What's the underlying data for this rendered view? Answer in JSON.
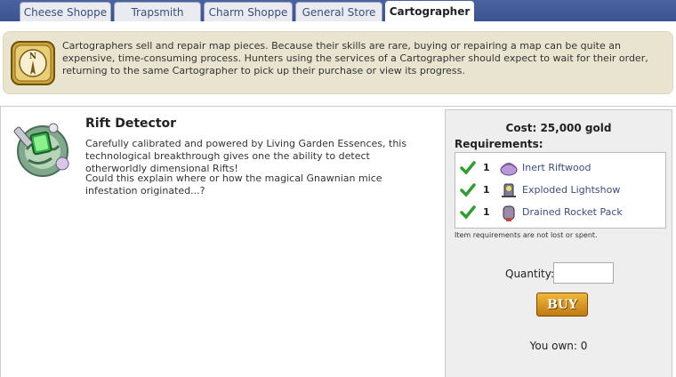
{
  "tabs": [
    {
      "label": "Cheese Shoppe",
      "active": false
    },
    {
      "label": "Trapsmith",
      "active": false
    },
    {
      "label": "Charm Shoppe",
      "active": false
    },
    {
      "label": "General Store",
      "active": false
    },
    {
      "label": "Cartographer",
      "active": true
    }
  ],
  "info": {
    "icon": "compass-icon",
    "text": "Cartographers sell and repair map pieces. Because their skills are rare, buying or repairing a map can be quite an expensive, time-consuming process. Hunters using the services of a Cartographer should expect to wait for their order, returning to the same Cartographer to pick up their purchase or view its progress."
  },
  "item": {
    "name": "Rift Detector",
    "description": "Carefully calibrated and powered by Living Garden Essences, this technological breakthrough gives one the ability to detect otherworldly dimensional Rifts!",
    "description2": "Could this explain where or how the magical Gnawnian mice infestation originated...?",
    "icon": "rift-detector-icon"
  },
  "purchase": {
    "cost": "Cost: 25,000 gold",
    "requirements_title": "Requirements:",
    "requirements": [
      {
        "qty": "1",
        "name": "Inert Riftwood",
        "icon": "riftwood-icon"
      },
      {
        "qty": "1",
        "name": "Exploded Lightshow",
        "icon": "lightshow-icon"
      },
      {
        "qty": "1",
        "name": "Drained Rocket Pack",
        "icon": "rocket-pack-icon"
      }
    ],
    "note": "Item requirements are not lost or spent.",
    "quantity_label": "Quantity:",
    "quantity_value": "",
    "buy_label": "BUY",
    "own_text": "You own: 0"
  },
  "colors": {
    "tabbar": "#3b5390",
    "info_bg": "#e9e4cf",
    "link": "#3b4f7a",
    "check": "#2e9e2e",
    "buy": "#d99520"
  }
}
